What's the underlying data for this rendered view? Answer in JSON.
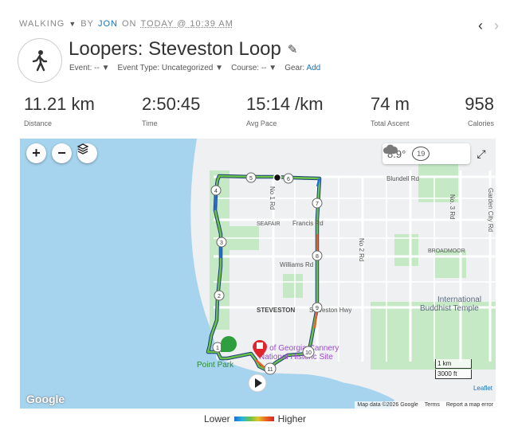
{
  "breadcrumb": {
    "activity_type": "WALKING",
    "by": "BY",
    "user": "JON",
    "on": "ON",
    "date": "TODAY @ 10:39 AM"
  },
  "title": "Loopers: Steveston Loop",
  "meta": {
    "event": "Event: --",
    "event_type": "Event Type: Uncategorized",
    "course": "Course: --",
    "gear": "Gear:",
    "gear_add": "Add"
  },
  "stats": [
    {
      "value": "11.21 km",
      "label": "Distance"
    },
    {
      "value": "2:50:45",
      "label": "Time"
    },
    {
      "value": "15:14 /km",
      "label": "Avg Pace"
    },
    {
      "value": "74 m",
      "label": "Total Ascent"
    },
    {
      "value": "958",
      "label": "Calories"
    }
  ],
  "map": {
    "weather_temp": "8.9°",
    "wind": "19",
    "labels": {
      "blundell": "Blundell Rd",
      "no3": "No. 3 Rd",
      "garden": "Garden City Rd",
      "no1": "No 1 Rd",
      "seafair": "SEAFAIR",
      "francis": "Francis Rd",
      "no2": "No 2 Rd",
      "broadmoor": "BROADMOOR",
      "williams": "Williams Rd",
      "steveston": "STEVESTON",
      "steveston_hwy": "Steveston Hwy",
      "intl1": "International",
      "intl2": "Buddhist Temple",
      "cannery1": "Gulf of Georgia Cannery",
      "cannery2": "National Historic Site",
      "point_park": "Point Park"
    },
    "markers": [
      "1",
      "2",
      "3",
      "4",
      "5",
      "6",
      "7",
      "8",
      "9",
      "10",
      "11"
    ],
    "scale_km": "1 km",
    "scale_ft": "3000 ft",
    "leaflet": "Leaflet",
    "google": "Google",
    "attribution": {
      "data": "Map data ©2026 Google",
      "terms": "Terms",
      "report": "Report a map error"
    }
  },
  "legend": {
    "lower": "Lower",
    "higher": "Higher"
  },
  "colors": {
    "accent": "#1a73b8",
    "water": "#a6d4ef",
    "land": "#e9ecef",
    "park": "#c5e8c5",
    "start": "#2e9e3e",
    "end": "#e0262d"
  }
}
